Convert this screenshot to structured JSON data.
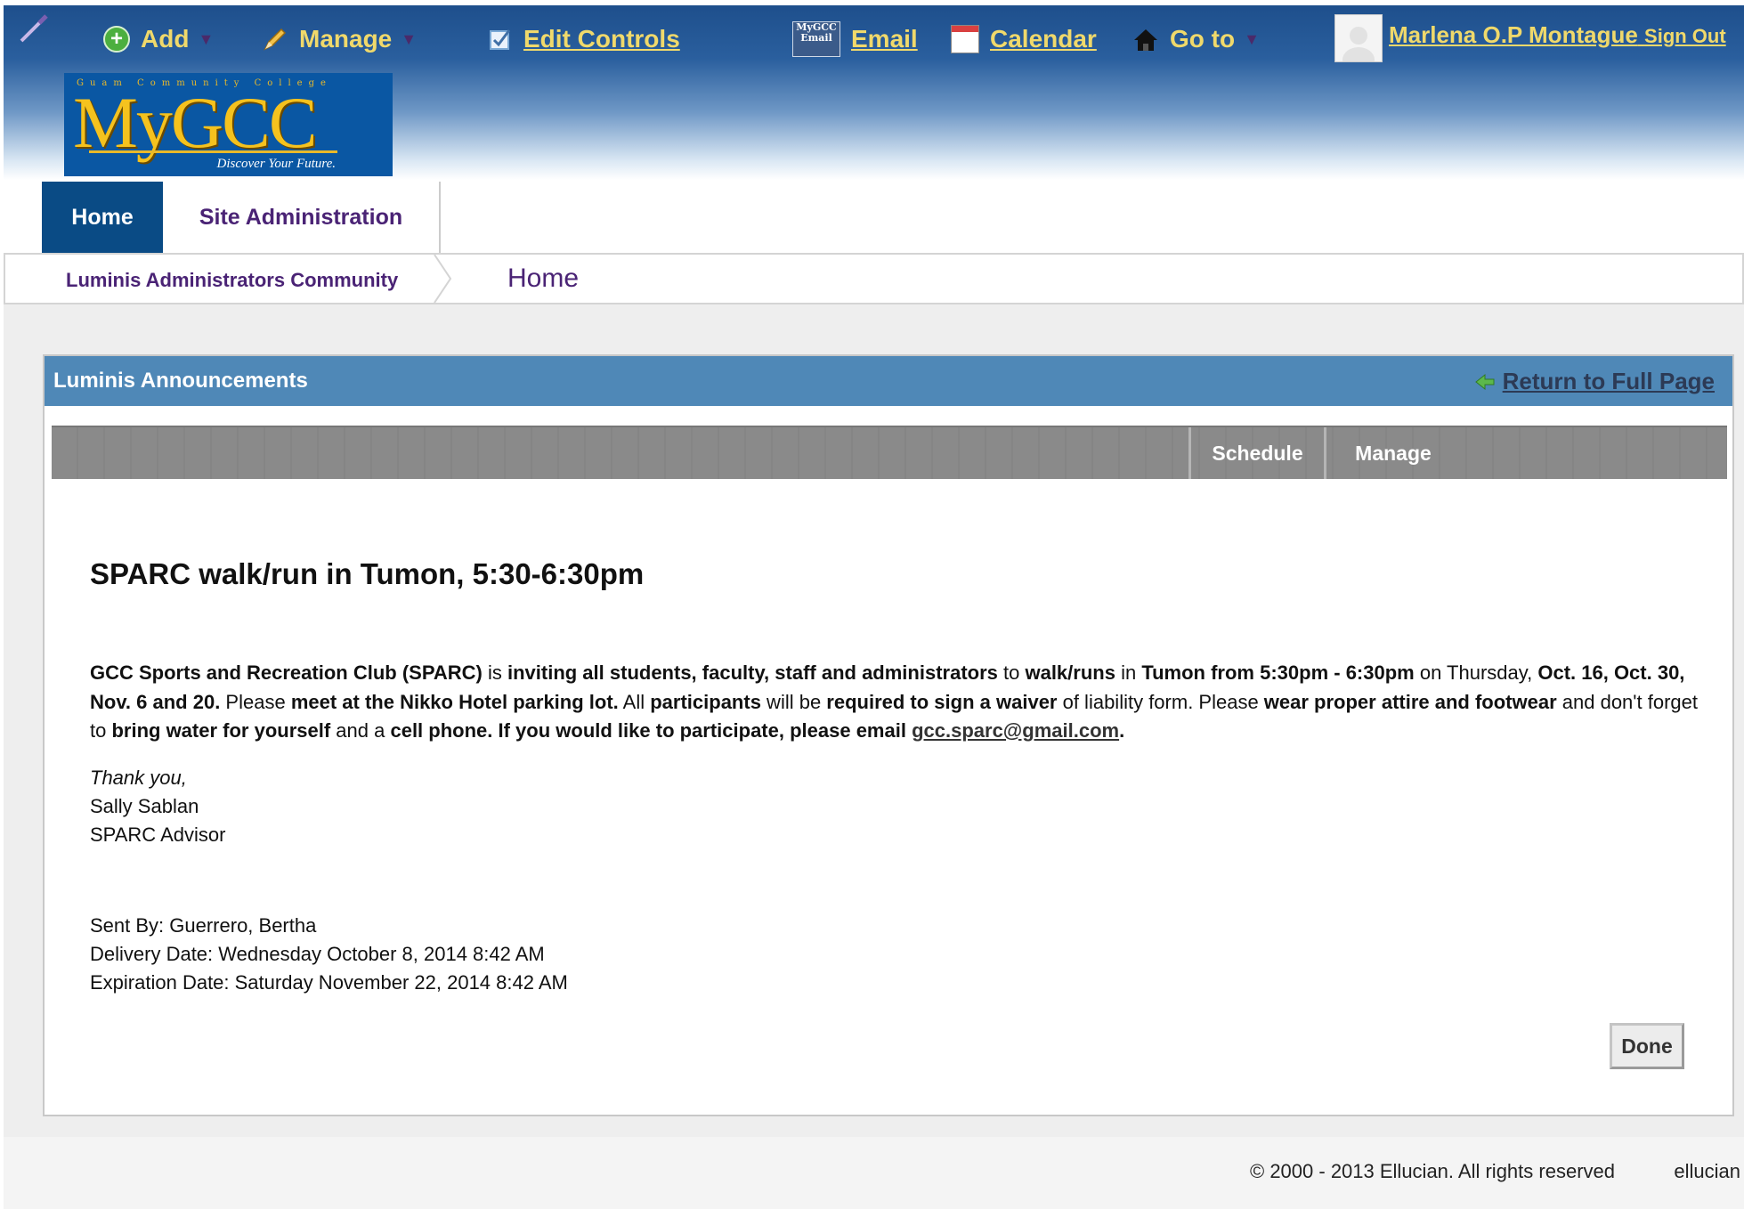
{
  "toolbar": {
    "add_label": "Add",
    "manage_label": "Manage",
    "edit_controls_label": "Edit Controls",
    "email_label": "Email",
    "email_icon_text": "MyGCC Email",
    "calendar_label": "Calendar",
    "goto_label": "Go to",
    "user_name": "Marlena O.P Montague",
    "sign_out_label": "Sign Out"
  },
  "logo": {
    "small_text": "Guam Community College",
    "name": "MyGCC",
    "tagline": "Discover Your Future."
  },
  "tabs": [
    {
      "label": "Home",
      "active": true
    },
    {
      "label": "Site Administration",
      "active": false
    }
  ],
  "breadcrumb": {
    "community": "Luminis Administrators Community",
    "current": "Home"
  },
  "panel": {
    "title": "Luminis Announcements",
    "return_link": "Return to Full Page",
    "schedule_label": "Schedule",
    "manage_label": "Manage",
    "done_label": "Done"
  },
  "announcement": {
    "title": "SPARC walk/run in Tumon, 5:30-6:30pm",
    "body": {
      "p1": "GCC Sports and Recreation Club (SPARC)",
      "p2": " is ",
      "p3": "inviting all students, faculty, staff and administrators",
      "p4": " to ",
      "p5": "walk/runs",
      "p6": " in ",
      "p7": "Tumon from 5:30pm - 6:30pm",
      "p8": " on Thursday, ",
      "p9": "Oct. 16, Oct. 30, Nov. 6 and 20.",
      "p10": "  Please ",
      "p11": "meet at the Nikko Hotel parking lot.",
      "p12": "  All ",
      "p13": "participants",
      "p14": " will be ",
      "p15": "required to sign a waiver",
      "p16": " of liability form.  Please ",
      "p17": "wear proper attire and footwear",
      "p18": " and don't forget to ",
      "p19": "bring water for yourself",
      "p20": " and a ",
      "p21": "cell phone.",
      "p22": "  If you would like to participate, please email ",
      "email": "gcc.sparc@gmail.com",
      "end": "."
    },
    "thank_you": "Thank you,",
    "signer": "Sally Sablan",
    "signer_title": "SPARC Advisor",
    "sent_by": "Sent By: Guerrero, Bertha",
    "delivery_date": "Delivery Date: Wednesday October 8, 2014 8:42 AM",
    "expiration_date": "Expiration Date: Saturday November 22, 2014 8:42 AM"
  },
  "footer": {
    "copyright": "© 2000 - 2013 Ellucian. All rights reserved",
    "brand": "ellucian"
  },
  "colors": {
    "header_blue": "#1e4f8c",
    "link_gold": "#f0d96b",
    "tab_active": "#0a4b85",
    "purple_text": "#4a2375",
    "panel_header": "#4f88b7"
  }
}
